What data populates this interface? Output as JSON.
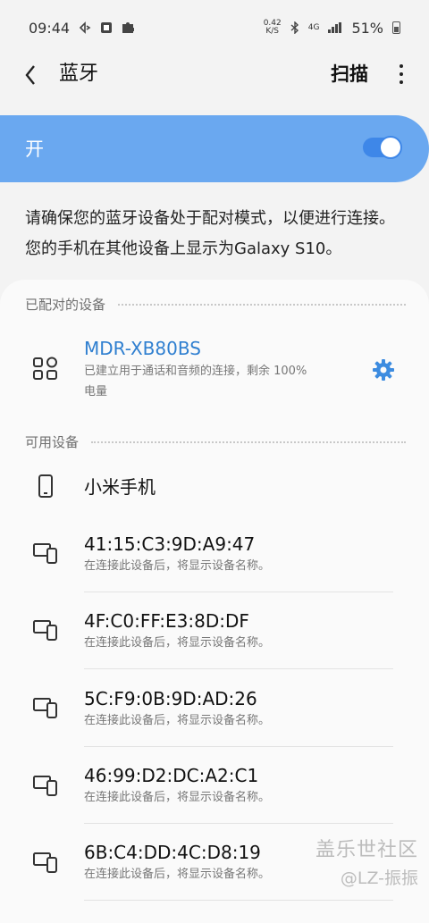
{
  "status": {
    "time": "09:44",
    "speed_top": "0.42",
    "speed_unit": "K/S",
    "network": "4G",
    "battery": "51%"
  },
  "header": {
    "back_icon": "chevron-left-icon",
    "title": "蓝牙",
    "scan_label": "扫描",
    "more_icon": "more-vert-icon"
  },
  "toggle": {
    "label": "开",
    "state": true,
    "color": "#6aa8f0"
  },
  "description": "请确保您的蓝牙设备处于配对模式，以便进行连接。 您的手机在其他设备上显示为Galaxy S10。",
  "paired": {
    "header": "已配对的设备",
    "device": {
      "name": "MDR-XB80BS",
      "status_line1": "已建立用于通话和音频的连接，剩余 100%",
      "status_line2": "电量",
      "icon": "headphones-grid-icon",
      "settings_icon": "gear-icon"
    }
  },
  "available": {
    "header": "可用设备",
    "devices": [
      {
        "name": "小米手机",
        "subtitle": "",
        "icon": "phone-icon"
      },
      {
        "name": "41:15:C3:9D:A9:47",
        "subtitle": "在连接此设备后，将显示设备名称。",
        "icon": "devices-icon"
      },
      {
        "name": "4F:C0:FF:E3:8D:DF",
        "subtitle": "在连接此设备后，将显示设备名称。",
        "icon": "devices-icon"
      },
      {
        "name": "5C:F9:0B:9D:AD:26",
        "subtitle": "在连接此设备后，将显示设备名称。",
        "icon": "devices-icon"
      },
      {
        "name": "46:99:D2:DC:A2:C1",
        "subtitle": "在连接此设备后，将显示设备名称。",
        "icon": "devices-icon"
      },
      {
        "name": "6B:C4:DD:4C:D8:19",
        "subtitle": "在连接此设备后，将显示设备名称。",
        "icon": "devices-icon"
      }
    ]
  },
  "watermark": {
    "line1": "盖乐世社区",
    "line2": "@LZ-振振"
  }
}
